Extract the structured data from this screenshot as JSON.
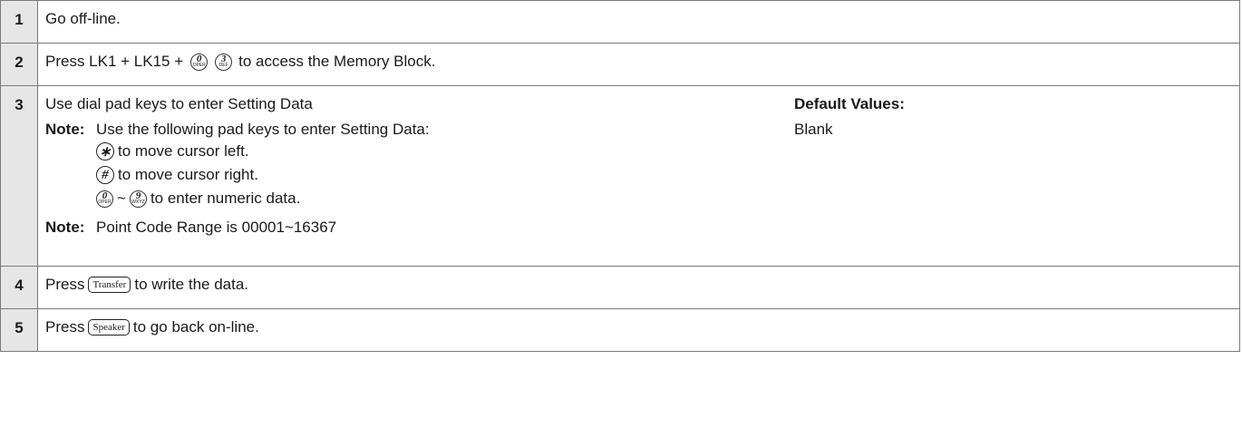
{
  "steps": [
    {
      "num": "1",
      "text": "Go off-line."
    },
    {
      "num": "2",
      "prefix": "Press LK1 + LK15 +",
      "key_a": "0",
      "key_a_sub": "OPER",
      "key_b": "3",
      "key_b_sub": "DEF",
      "suffix": "to access the Memory Block."
    },
    {
      "num": "3",
      "text": "Use dial pad keys to enter Setting Data",
      "note_label": "Note:",
      "note_text": "Use the following pad keys to enter Setting Data:",
      "items": [
        {
          "key": "∗",
          "text": "to move cursor left."
        },
        {
          "key": "#",
          "text": "to move cursor right."
        }
      ],
      "range_key_a": "0",
      "range_key_a_sub": "OPER",
      "range_sep": "~",
      "range_key_b": "9",
      "range_key_b_sub": "WXYZ",
      "range_text": "to enter numeric data.",
      "note2_label": "Note:",
      "note2_text": "Point Code Range is 00001~16367",
      "default_label": "Default Values:",
      "default_value": "Blank"
    },
    {
      "num": "4",
      "prefix": "Press",
      "key": "Transfer",
      "suffix": "to write the data."
    },
    {
      "num": "5",
      "prefix": "Press",
      "key": "Speaker",
      "suffix": "to go back on-line."
    }
  ]
}
